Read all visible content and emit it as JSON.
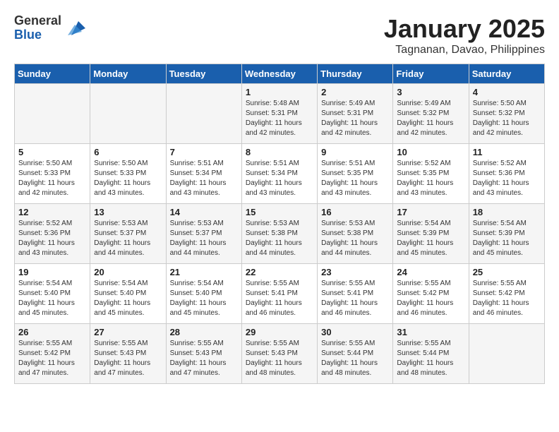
{
  "logo": {
    "general": "General",
    "blue": "Blue"
  },
  "header": {
    "title": "January 2025",
    "location": "Tagnanan, Davao, Philippines"
  },
  "days_of_week": [
    "Sunday",
    "Monday",
    "Tuesday",
    "Wednesday",
    "Thursday",
    "Friday",
    "Saturday"
  ],
  "weeks": [
    [
      {
        "day": "",
        "info": ""
      },
      {
        "day": "",
        "info": ""
      },
      {
        "day": "",
        "info": ""
      },
      {
        "day": "1",
        "info": "Sunrise: 5:48 AM\nSunset: 5:31 PM\nDaylight: 11 hours\nand 42 minutes."
      },
      {
        "day": "2",
        "info": "Sunrise: 5:49 AM\nSunset: 5:31 PM\nDaylight: 11 hours\nand 42 minutes."
      },
      {
        "day": "3",
        "info": "Sunrise: 5:49 AM\nSunset: 5:32 PM\nDaylight: 11 hours\nand 42 minutes."
      },
      {
        "day": "4",
        "info": "Sunrise: 5:50 AM\nSunset: 5:32 PM\nDaylight: 11 hours\nand 42 minutes."
      }
    ],
    [
      {
        "day": "5",
        "info": "Sunrise: 5:50 AM\nSunset: 5:33 PM\nDaylight: 11 hours\nand 42 minutes."
      },
      {
        "day": "6",
        "info": "Sunrise: 5:50 AM\nSunset: 5:33 PM\nDaylight: 11 hours\nand 43 minutes."
      },
      {
        "day": "7",
        "info": "Sunrise: 5:51 AM\nSunset: 5:34 PM\nDaylight: 11 hours\nand 43 minutes."
      },
      {
        "day": "8",
        "info": "Sunrise: 5:51 AM\nSunset: 5:34 PM\nDaylight: 11 hours\nand 43 minutes."
      },
      {
        "day": "9",
        "info": "Sunrise: 5:51 AM\nSunset: 5:35 PM\nDaylight: 11 hours\nand 43 minutes."
      },
      {
        "day": "10",
        "info": "Sunrise: 5:52 AM\nSunset: 5:35 PM\nDaylight: 11 hours\nand 43 minutes."
      },
      {
        "day": "11",
        "info": "Sunrise: 5:52 AM\nSunset: 5:36 PM\nDaylight: 11 hours\nand 43 minutes."
      }
    ],
    [
      {
        "day": "12",
        "info": "Sunrise: 5:52 AM\nSunset: 5:36 PM\nDaylight: 11 hours\nand 43 minutes."
      },
      {
        "day": "13",
        "info": "Sunrise: 5:53 AM\nSunset: 5:37 PM\nDaylight: 11 hours\nand 44 minutes."
      },
      {
        "day": "14",
        "info": "Sunrise: 5:53 AM\nSunset: 5:37 PM\nDaylight: 11 hours\nand 44 minutes."
      },
      {
        "day": "15",
        "info": "Sunrise: 5:53 AM\nSunset: 5:38 PM\nDaylight: 11 hours\nand 44 minutes."
      },
      {
        "day": "16",
        "info": "Sunrise: 5:53 AM\nSunset: 5:38 PM\nDaylight: 11 hours\nand 44 minutes."
      },
      {
        "day": "17",
        "info": "Sunrise: 5:54 AM\nSunset: 5:39 PM\nDaylight: 11 hours\nand 45 minutes."
      },
      {
        "day": "18",
        "info": "Sunrise: 5:54 AM\nSunset: 5:39 PM\nDaylight: 11 hours\nand 45 minutes."
      }
    ],
    [
      {
        "day": "19",
        "info": "Sunrise: 5:54 AM\nSunset: 5:40 PM\nDaylight: 11 hours\nand 45 minutes."
      },
      {
        "day": "20",
        "info": "Sunrise: 5:54 AM\nSunset: 5:40 PM\nDaylight: 11 hours\nand 45 minutes."
      },
      {
        "day": "21",
        "info": "Sunrise: 5:54 AM\nSunset: 5:40 PM\nDaylight: 11 hours\nand 45 minutes."
      },
      {
        "day": "22",
        "info": "Sunrise: 5:55 AM\nSunset: 5:41 PM\nDaylight: 11 hours\nand 46 minutes."
      },
      {
        "day": "23",
        "info": "Sunrise: 5:55 AM\nSunset: 5:41 PM\nDaylight: 11 hours\nand 46 minutes."
      },
      {
        "day": "24",
        "info": "Sunrise: 5:55 AM\nSunset: 5:42 PM\nDaylight: 11 hours\nand 46 minutes."
      },
      {
        "day": "25",
        "info": "Sunrise: 5:55 AM\nSunset: 5:42 PM\nDaylight: 11 hours\nand 46 minutes."
      }
    ],
    [
      {
        "day": "26",
        "info": "Sunrise: 5:55 AM\nSunset: 5:42 PM\nDaylight: 11 hours\nand 47 minutes."
      },
      {
        "day": "27",
        "info": "Sunrise: 5:55 AM\nSunset: 5:43 PM\nDaylight: 11 hours\nand 47 minutes."
      },
      {
        "day": "28",
        "info": "Sunrise: 5:55 AM\nSunset: 5:43 PM\nDaylight: 11 hours\nand 47 minutes."
      },
      {
        "day": "29",
        "info": "Sunrise: 5:55 AM\nSunset: 5:43 PM\nDaylight: 11 hours\nand 48 minutes."
      },
      {
        "day": "30",
        "info": "Sunrise: 5:55 AM\nSunset: 5:44 PM\nDaylight: 11 hours\nand 48 minutes."
      },
      {
        "day": "31",
        "info": "Sunrise: 5:55 AM\nSunset: 5:44 PM\nDaylight: 11 hours\nand 48 minutes."
      },
      {
        "day": "",
        "info": ""
      }
    ]
  ]
}
